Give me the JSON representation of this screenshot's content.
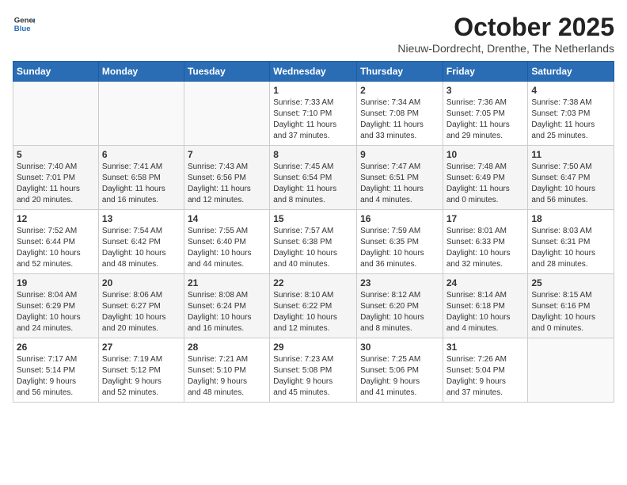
{
  "header": {
    "logo_general": "General",
    "logo_blue": "Blue",
    "month_title": "October 2025",
    "location": "Nieuw-Dordrecht, Drenthe, The Netherlands"
  },
  "weekdays": [
    "Sunday",
    "Monday",
    "Tuesday",
    "Wednesday",
    "Thursday",
    "Friday",
    "Saturday"
  ],
  "weeks": [
    [
      {
        "day": "",
        "info": ""
      },
      {
        "day": "",
        "info": ""
      },
      {
        "day": "",
        "info": ""
      },
      {
        "day": "1",
        "info": "Sunrise: 7:33 AM\nSunset: 7:10 PM\nDaylight: 11 hours\nand 37 minutes."
      },
      {
        "day": "2",
        "info": "Sunrise: 7:34 AM\nSunset: 7:08 PM\nDaylight: 11 hours\nand 33 minutes."
      },
      {
        "day": "3",
        "info": "Sunrise: 7:36 AM\nSunset: 7:05 PM\nDaylight: 11 hours\nand 29 minutes."
      },
      {
        "day": "4",
        "info": "Sunrise: 7:38 AM\nSunset: 7:03 PM\nDaylight: 11 hours\nand 25 minutes."
      }
    ],
    [
      {
        "day": "5",
        "info": "Sunrise: 7:40 AM\nSunset: 7:01 PM\nDaylight: 11 hours\nand 20 minutes."
      },
      {
        "day": "6",
        "info": "Sunrise: 7:41 AM\nSunset: 6:58 PM\nDaylight: 11 hours\nand 16 minutes."
      },
      {
        "day": "7",
        "info": "Sunrise: 7:43 AM\nSunset: 6:56 PM\nDaylight: 11 hours\nand 12 minutes."
      },
      {
        "day": "8",
        "info": "Sunrise: 7:45 AM\nSunset: 6:54 PM\nDaylight: 11 hours\nand 8 minutes."
      },
      {
        "day": "9",
        "info": "Sunrise: 7:47 AM\nSunset: 6:51 PM\nDaylight: 11 hours\nand 4 minutes."
      },
      {
        "day": "10",
        "info": "Sunrise: 7:48 AM\nSunset: 6:49 PM\nDaylight: 11 hours\nand 0 minutes."
      },
      {
        "day": "11",
        "info": "Sunrise: 7:50 AM\nSunset: 6:47 PM\nDaylight: 10 hours\nand 56 minutes."
      }
    ],
    [
      {
        "day": "12",
        "info": "Sunrise: 7:52 AM\nSunset: 6:44 PM\nDaylight: 10 hours\nand 52 minutes."
      },
      {
        "day": "13",
        "info": "Sunrise: 7:54 AM\nSunset: 6:42 PM\nDaylight: 10 hours\nand 48 minutes."
      },
      {
        "day": "14",
        "info": "Sunrise: 7:55 AM\nSunset: 6:40 PM\nDaylight: 10 hours\nand 44 minutes."
      },
      {
        "day": "15",
        "info": "Sunrise: 7:57 AM\nSunset: 6:38 PM\nDaylight: 10 hours\nand 40 minutes."
      },
      {
        "day": "16",
        "info": "Sunrise: 7:59 AM\nSunset: 6:35 PM\nDaylight: 10 hours\nand 36 minutes."
      },
      {
        "day": "17",
        "info": "Sunrise: 8:01 AM\nSunset: 6:33 PM\nDaylight: 10 hours\nand 32 minutes."
      },
      {
        "day": "18",
        "info": "Sunrise: 8:03 AM\nSunset: 6:31 PM\nDaylight: 10 hours\nand 28 minutes."
      }
    ],
    [
      {
        "day": "19",
        "info": "Sunrise: 8:04 AM\nSunset: 6:29 PM\nDaylight: 10 hours\nand 24 minutes."
      },
      {
        "day": "20",
        "info": "Sunrise: 8:06 AM\nSunset: 6:27 PM\nDaylight: 10 hours\nand 20 minutes."
      },
      {
        "day": "21",
        "info": "Sunrise: 8:08 AM\nSunset: 6:24 PM\nDaylight: 10 hours\nand 16 minutes."
      },
      {
        "day": "22",
        "info": "Sunrise: 8:10 AM\nSunset: 6:22 PM\nDaylight: 10 hours\nand 12 minutes."
      },
      {
        "day": "23",
        "info": "Sunrise: 8:12 AM\nSunset: 6:20 PM\nDaylight: 10 hours\nand 8 minutes."
      },
      {
        "day": "24",
        "info": "Sunrise: 8:14 AM\nSunset: 6:18 PM\nDaylight: 10 hours\nand 4 minutes."
      },
      {
        "day": "25",
        "info": "Sunrise: 8:15 AM\nSunset: 6:16 PM\nDaylight: 10 hours\nand 0 minutes."
      }
    ],
    [
      {
        "day": "26",
        "info": "Sunrise: 7:17 AM\nSunset: 5:14 PM\nDaylight: 9 hours\nand 56 minutes."
      },
      {
        "day": "27",
        "info": "Sunrise: 7:19 AM\nSunset: 5:12 PM\nDaylight: 9 hours\nand 52 minutes."
      },
      {
        "day": "28",
        "info": "Sunrise: 7:21 AM\nSunset: 5:10 PM\nDaylight: 9 hours\nand 48 minutes."
      },
      {
        "day": "29",
        "info": "Sunrise: 7:23 AM\nSunset: 5:08 PM\nDaylight: 9 hours\nand 45 minutes."
      },
      {
        "day": "30",
        "info": "Sunrise: 7:25 AM\nSunset: 5:06 PM\nDaylight: 9 hours\nand 41 minutes."
      },
      {
        "day": "31",
        "info": "Sunrise: 7:26 AM\nSunset: 5:04 PM\nDaylight: 9 hours\nand 37 minutes."
      },
      {
        "day": "",
        "info": ""
      }
    ]
  ]
}
